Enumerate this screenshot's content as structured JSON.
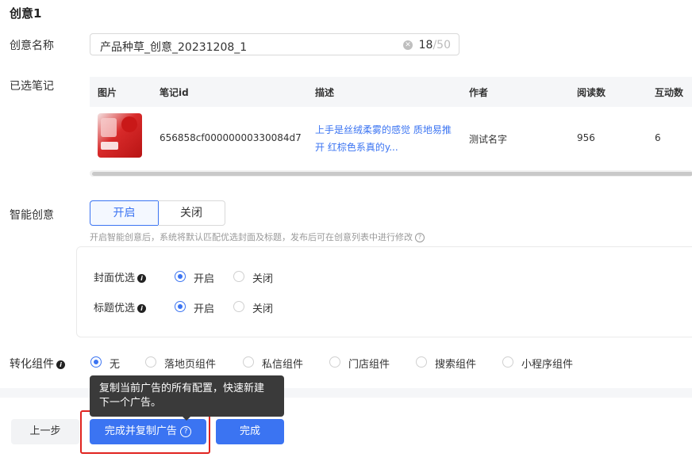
{
  "section_title": "创意1",
  "creative_name": {
    "label": "创意名称",
    "value": "产品种草_创意_20231208_1",
    "count": "18",
    "max": "/50"
  },
  "selected_notes": {
    "label": "已选笔记",
    "columns": [
      "图片",
      "笔记id",
      "描述",
      "作者",
      "阅读数",
      "互动数"
    ],
    "rows": [
      {
        "note_id": "656858cf00000000330084d7",
        "desc_line1": "上手是丝绒柔雾的感觉 质地易推",
        "desc_line2": "开 红棕色系真的y...",
        "author": "测试名字",
        "reads": "956",
        "interactions": "6"
      }
    ]
  },
  "smart_creative": {
    "label": "智能创意",
    "on_label": "开启",
    "off_label": "关闭",
    "hint": "开启智能创意后，系统将默认匹配优选封面及标题，发布后可在创意列表中进行修改",
    "cover": {
      "label": "封面优选",
      "on": "开启",
      "off": "关闭"
    },
    "title": {
      "label": "标题优选",
      "on": "开启",
      "off": "关闭"
    }
  },
  "conversion": {
    "label": "转化组件",
    "options": [
      "无",
      "落地页组件",
      "私信组件",
      "门店组件",
      "搜索组件",
      "小程序组件"
    ]
  },
  "tooltip": {
    "line1": "复制当前广告的所有配置，快速新建",
    "line2": "下一个广告。"
  },
  "buttons": {
    "prev": "上一步",
    "copy": "完成并复制广告",
    "done": "完成"
  },
  "colors": {
    "accent": "#3b74f2",
    "highlight": "#e0241f",
    "tooltip_bg": "#3a3a3a"
  }
}
